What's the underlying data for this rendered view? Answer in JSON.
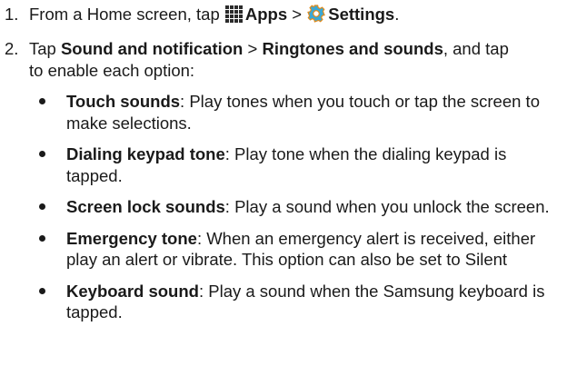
{
  "steps": [
    {
      "number": "1.",
      "prefix": "From a Home screen, tap ",
      "apps_icon": "apps-grid-icon",
      "apps_label": "Apps",
      "separator": " > ",
      "settings_icon": "settings-gear-icon",
      "settings_label": "Settings",
      "suffix": "."
    },
    {
      "number": "2.",
      "prefix": "Tap ",
      "sound_label": "Sound and notification",
      "separator": " > ",
      "ringtones_label": "Ringtones and sounds",
      "after": ", and tap",
      "line2": "to enable each option:",
      "options": [
        {
          "term": "Touch sounds",
          "desc": ": Play tones when you touch or tap the screen to make selections."
        },
        {
          "term": "Dialing keypad tone",
          "desc": ": Play tone when the dialing keypad is tapped."
        },
        {
          "term": "Screen lock sounds",
          "desc": ": Play a sound when you unlock the screen."
        },
        {
          "term": "Emergency tone",
          "desc": ": When an emergency alert is received, either play an alert or vibrate. This option can also be set to Silent"
        },
        {
          "term": "Keyboard sound",
          "desc": ": Play a sound when the Samsung keyboard is tapped."
        }
      ]
    }
  ],
  "colors": {
    "text": "#1a1a1a",
    "apps_icon": "#2b2b2b",
    "settings_icon_fill": "#3aa8d6",
    "settings_icon_stroke": "#e08a1a"
  }
}
